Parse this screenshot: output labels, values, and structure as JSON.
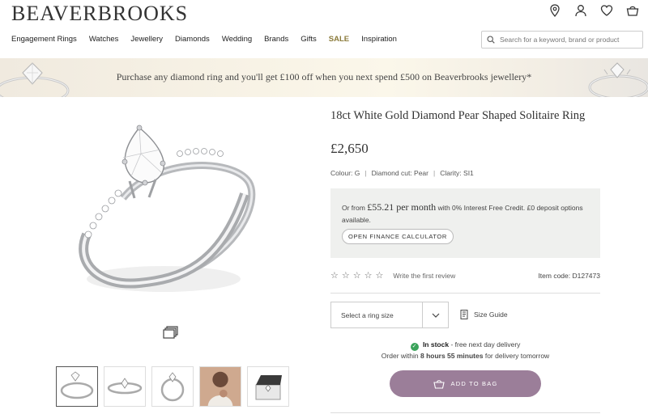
{
  "brand": {
    "logo_text": "BEAVERBROOKS"
  },
  "header_icons": [
    "location-pin-icon",
    "account-icon",
    "heart-icon",
    "bag-icon"
  ],
  "nav": {
    "items": [
      "Engagement Rings",
      "Watches",
      "Jewellery",
      "Diamonds",
      "Wedding",
      "Brands",
      "Gifts",
      "SALE",
      "Inspiration"
    ]
  },
  "search": {
    "placeholder": "Search for a keyword, brand or product"
  },
  "banner": {
    "text": "Purchase any diamond ring and you'll get £100 off when you next spend £500 on Beaverbrooks jewellery*"
  },
  "product": {
    "title": "18ct White Gold Diamond Pear Shaped Solitaire Ring",
    "price": "£2,650",
    "specs": {
      "colour": "Colour: G",
      "cut": "Diamond cut: Pear",
      "clarity": "Clarity: SI1"
    },
    "finance": {
      "prefix": "Or from",
      "amount": "£55.21 per month",
      "suffix": "with 0% Interest Free Credit. £0 deposit options available.",
      "button": "OPEN FINANCE CALCULATOR"
    },
    "rating": {
      "stars": 0,
      "max": 5,
      "review_link": "Write the first review"
    },
    "item_code": "Item code: D127473",
    "ring_size_placeholder": "Select a ring size",
    "size_guide": "Size Guide",
    "stock": {
      "status": "In stock",
      "delivery": "- free next day delivery"
    },
    "order": {
      "prefix": "Order within",
      "time": "8 hours 55 minutes",
      "suffix": "for delivery tomorrow"
    },
    "add_to_bag": "ADD TO BAG"
  },
  "thumbnails": [
    "ring-angle-view",
    "ring-side-view",
    "ring-front-view",
    "ring-on-model",
    "ring-in-box"
  ],
  "colors": {
    "accent_button": "#9b7e99",
    "sale": "#8a7a3a",
    "in_stock": "#3aa35a",
    "finance_bg": "#eff0ee"
  }
}
